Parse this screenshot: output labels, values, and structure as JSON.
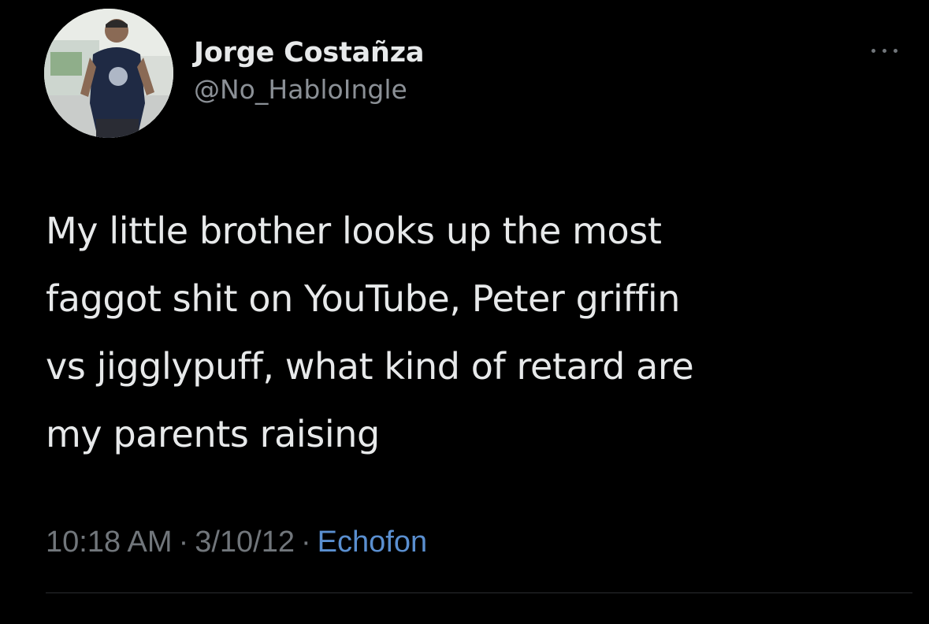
{
  "tweet": {
    "author": {
      "display_name": "Jorge Costañza",
      "handle": "@No_HabloIngle"
    },
    "text": "My little brother looks up the most\nfaggot shit on YouTube, Peter griffin\nvs jigglypuff, what kind of retard are\nmy parents raising",
    "meta": {
      "time": "10:18 AM",
      "separator": "·",
      "date": "3/10/12",
      "client": "Echofon"
    },
    "icons": {
      "avatar": "profile-photo",
      "more": "more-options-icon"
    }
  },
  "colors": {
    "background": "#000000",
    "primary_text": "#e7e9ea",
    "secondary_text": "#71767b",
    "link": "#5a8fd0"
  }
}
